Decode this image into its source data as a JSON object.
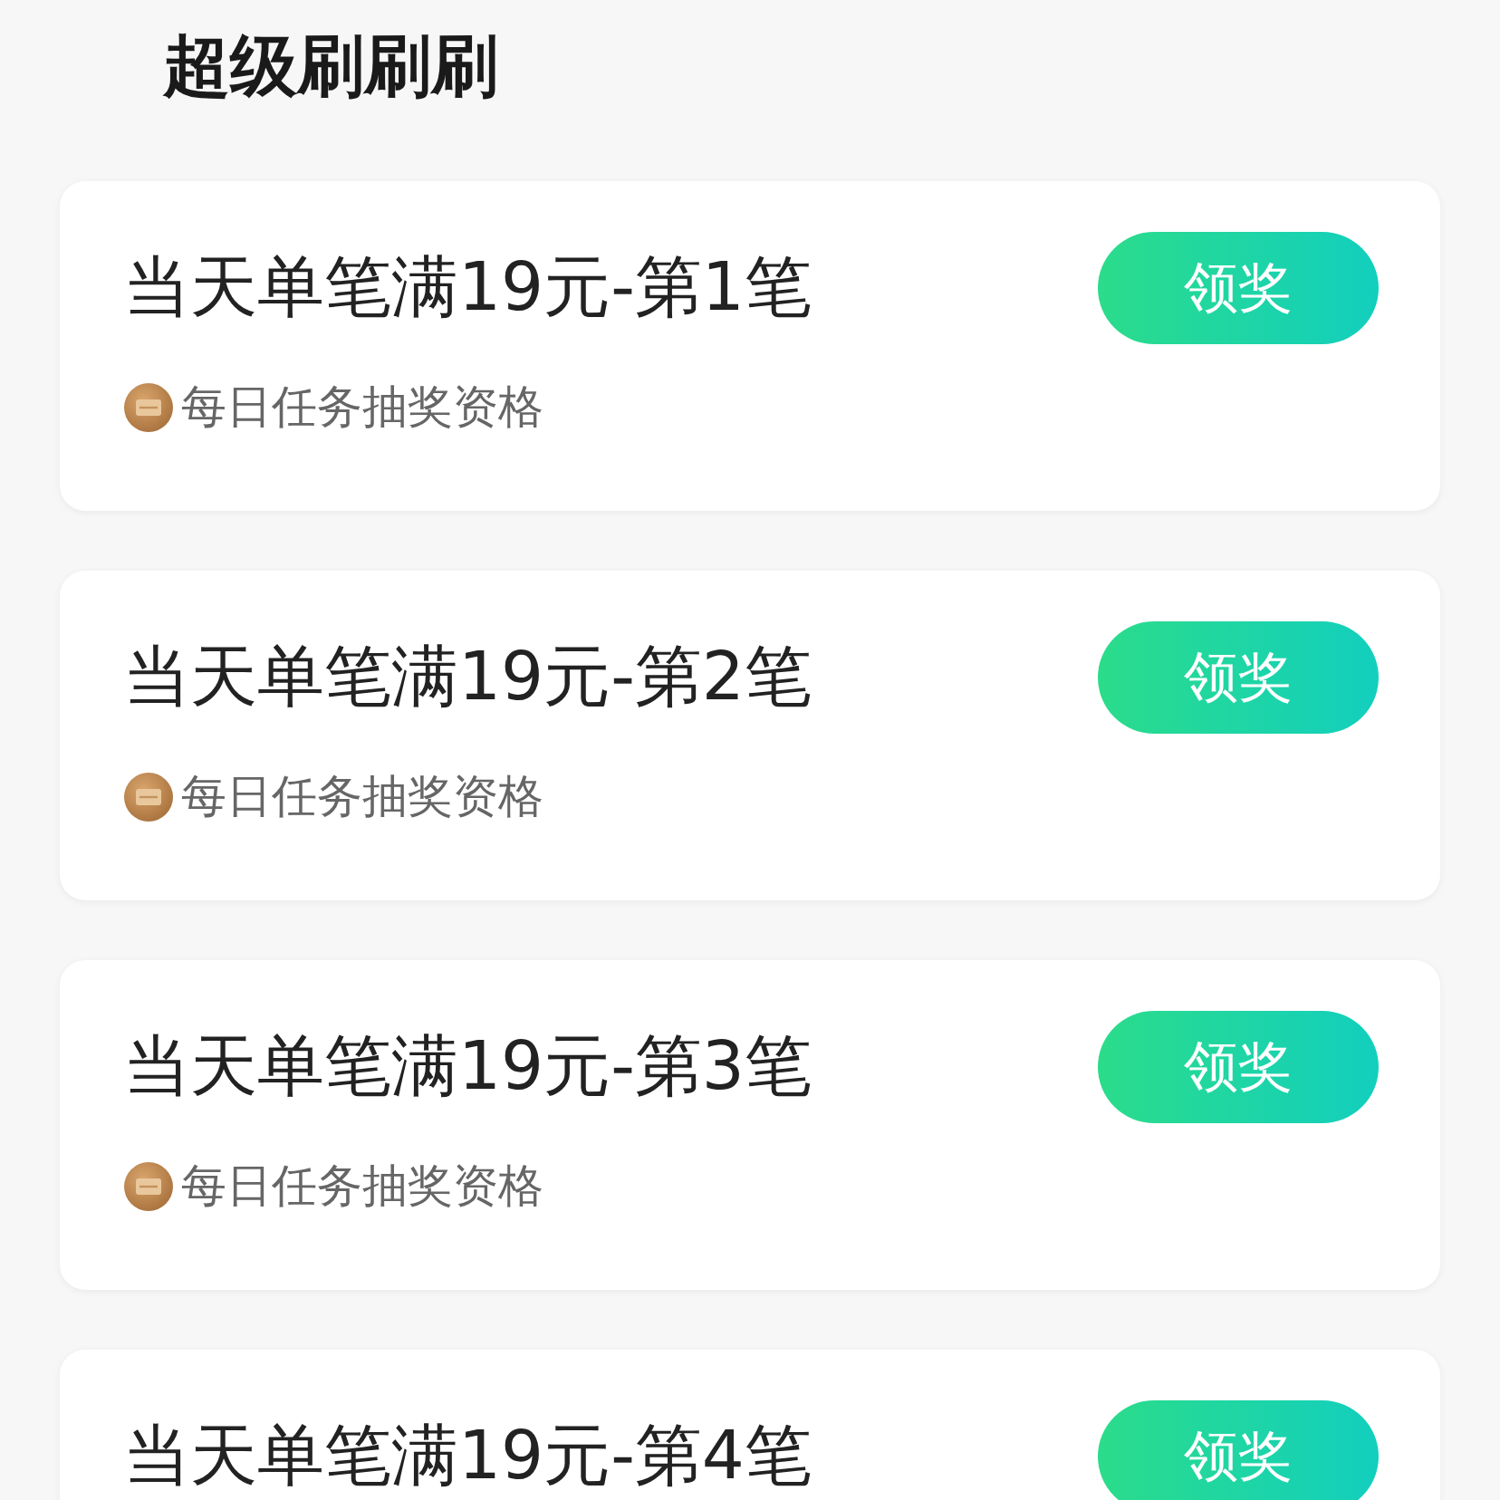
{
  "title": "超级刷刷刷",
  "tasks": [
    {
      "name": "当天单笔满19元-第1笔",
      "button": "领奖",
      "note": "每日任务抽奖资格"
    },
    {
      "name": "当天单笔满19元-第2笔",
      "button": "领奖",
      "note": "每日任务抽奖资格"
    },
    {
      "name": "当天单笔满19元-第3笔",
      "button": "领奖",
      "note": "每日任务抽奖资格"
    },
    {
      "name": "当天单笔满19元-第4笔",
      "button": "领奖"
    }
  ]
}
